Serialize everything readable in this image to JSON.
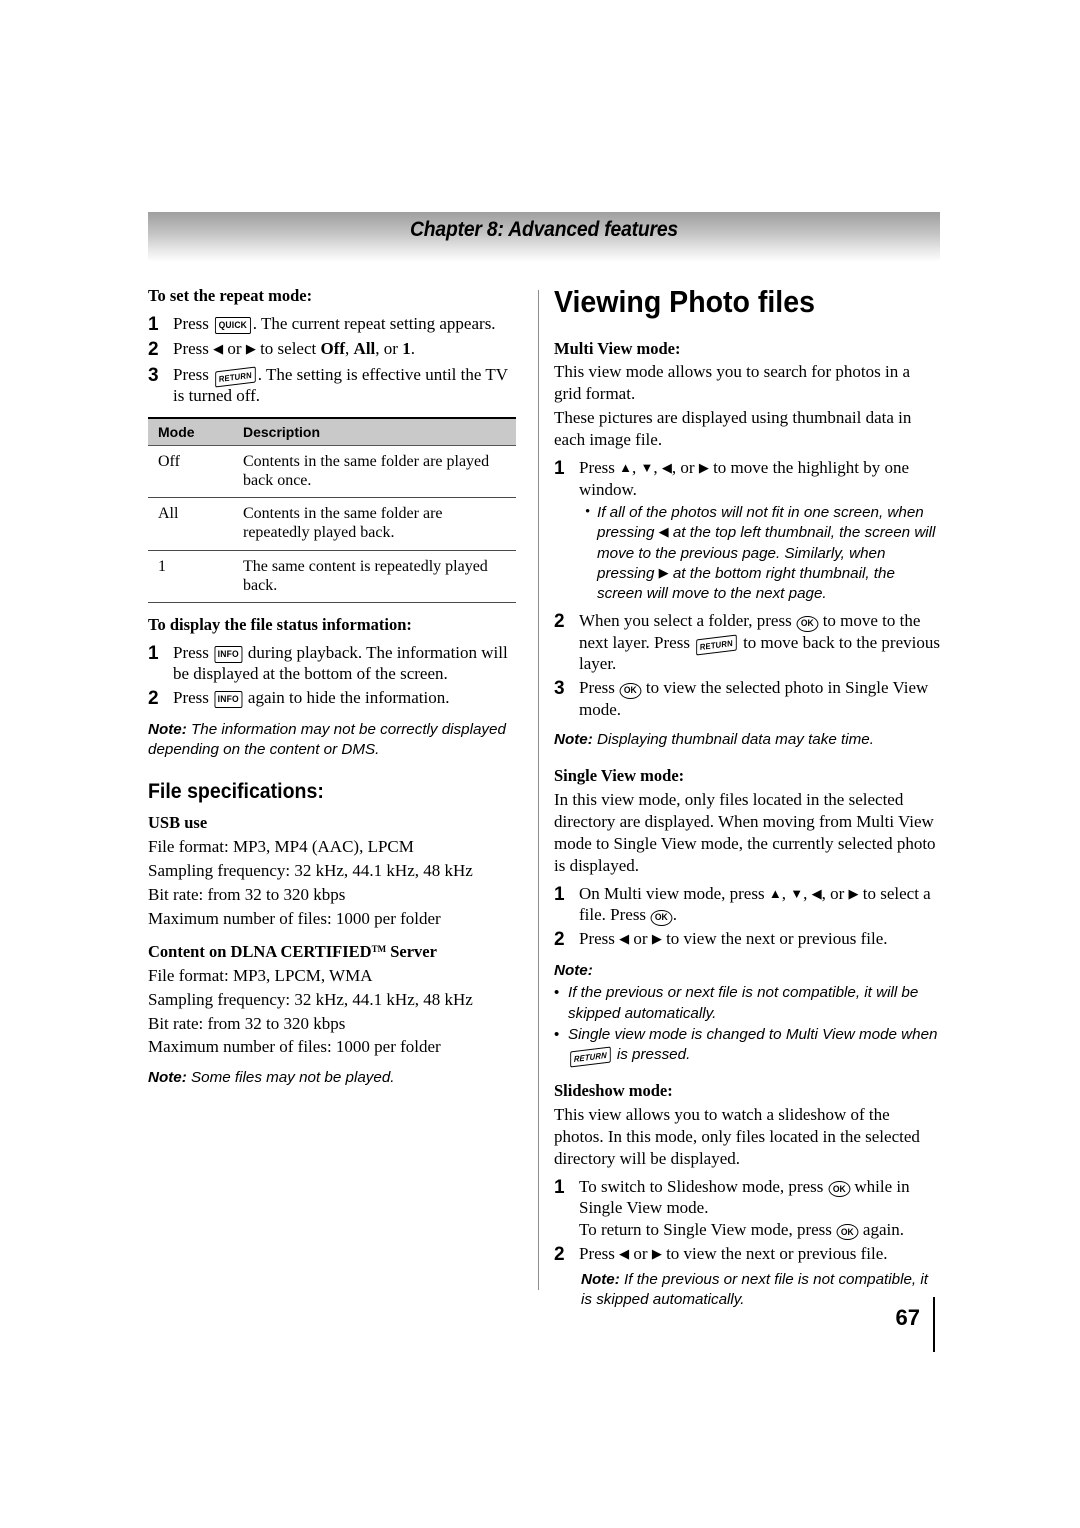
{
  "header": {
    "chapter_title": "Chapter 8: Advanced features"
  },
  "left_column": {
    "repeat_mode": {
      "heading": "To set the repeat mode:",
      "steps": [
        {
          "num": "1",
          "pre": "Press ",
          "key": "QUICK",
          "post": ". The current repeat setting appears."
        },
        {
          "num": "2",
          "pre": "Press ",
          "mid": " or ",
          "post_a": " to select ",
          "opt1": "Off",
          "sep1": ", ",
          "opt2": "All",
          "sep2": ", or ",
          "opt3": "1",
          "end": "."
        },
        {
          "num": "3",
          "pre": "Press ",
          "key": "RETURN",
          "post": ". The setting is effective until the TV is turned off."
        }
      ]
    },
    "mode_table": {
      "headers": [
        "Mode",
        "Description"
      ],
      "rows": [
        [
          "Off",
          "Contents in the same folder are played back once."
        ],
        [
          "All",
          "Contents in the same folder are repeatedly played back."
        ],
        [
          "1",
          "The same content is repeatedly played back."
        ]
      ]
    },
    "file_status": {
      "heading": "To display the file status information:",
      "steps": [
        {
          "num": "1",
          "pre": "Press ",
          "key": "INFO",
          "post": " during playback. The information will be displayed at the bottom of the screen."
        },
        {
          "num": "2",
          "pre": "Press ",
          "key": "INFO",
          "post": " again to hide the information."
        }
      ],
      "note_label": "Note:",
      "note_text": " The information may not be correctly displayed depending on the content or DMS."
    },
    "file_specifications": {
      "heading": "File specifications:",
      "usb": {
        "subheading": "USB use",
        "lines": [
          "File format: MP3, MP4 (AAC), LPCM",
          "Sampling frequency: 32 kHz, 44.1 kHz, 48 kHz",
          "Bit rate: from 32 to 320 kbps",
          "Maximum number of files: 1000 per folder"
        ]
      },
      "dlna": {
        "subheading_a": "Content on DLNA CERTIFIED",
        "subheading_tm": "TM",
        "subheading_b": " Server",
        "lines": [
          "File format: MP3, LPCM, WMA",
          "Sampling frequency: 32 kHz, 44.1 kHz, 48 kHz",
          "Bit rate: from 32 to 320 kbps",
          "Maximum number of files: 1000 per folder"
        ]
      },
      "note_label": "Note:",
      "note_text": " Some files may not be played."
    }
  },
  "right_column": {
    "title": "Viewing Photo files",
    "multi_view": {
      "subheading": "Multi View mode:",
      "paragraphs": [
        "This view mode allows you to search for photos in a grid format.",
        "These pictures are displayed using thumbnail data in each image file."
      ],
      "step1": {
        "num": "1",
        "pre": "Press ",
        "sep_a": ", ",
        "sep_b": ", ",
        "sep_c": ", or ",
        "post": " to move the highlight by one window."
      },
      "step1_sub": {
        "a": "If all of the photos will not fit in one screen, when pressing ",
        "b": " at the top left thumbnail, the screen will move to the previous page. Similarly, when pressing ",
        "c": " at the bottom right thumbnail, the screen will move to the next page."
      },
      "step2": {
        "num": "2",
        "a": "When you select a folder, press ",
        "key1": "OK",
        "b": " to move to the next layer. Press ",
        "key2": "RETURN",
        "c": " to move back to the previous layer."
      },
      "step3": {
        "num": "3",
        "a": "Press ",
        "key1": "OK",
        "b": " to view the selected photo in Single View mode."
      },
      "note_label": "Note:",
      "note_text": " Displaying thumbnail data may take time."
    },
    "single_view": {
      "subheading": "Single View mode:",
      "paragraph": "In this view mode, only files located in the selected directory are displayed. When moving from Multi View mode to Single View mode, the currently selected photo is displayed.",
      "step1": {
        "num": "1",
        "a": "On Multi view mode, press ",
        "sep_a": ", ",
        "sep_b": ", ",
        "sep_c": ", or ",
        "b": " to select a file. Press ",
        "key1": "OK",
        "c": "."
      },
      "step2": {
        "num": "2",
        "a": "Press ",
        "mid": " or ",
        "b": " to view the next or previous file."
      },
      "note_label": "Note:",
      "note_items": [
        "If the previous or next file is not compatible, it will be skipped automatically.",
        "Single view mode is changed to Multi View mode when "
      ],
      "note_item2_key": "RETURN",
      "note_item2_tail": " is pressed."
    },
    "slideshow": {
      "subheading": "Slideshow mode:",
      "paragraph": "This view allows you to watch a slideshow of the photos. In this mode, only files located in the selected directory will be displayed.",
      "step1": {
        "num": "1",
        "a": "To switch to Slideshow mode, press ",
        "key1": "OK",
        "b": " while in Single View mode.",
        "c": "To return to Single View mode, press ",
        "key2": "OK",
        "d": " again."
      },
      "step2": {
        "num": "2",
        "a": "Press ",
        "mid": " or ",
        "b": " to view the next or previous file."
      },
      "note_label": "Note:",
      "note_text": " If the previous or next file is not compatible, it is skipped automatically."
    }
  },
  "footer": {
    "page_number": "67"
  }
}
